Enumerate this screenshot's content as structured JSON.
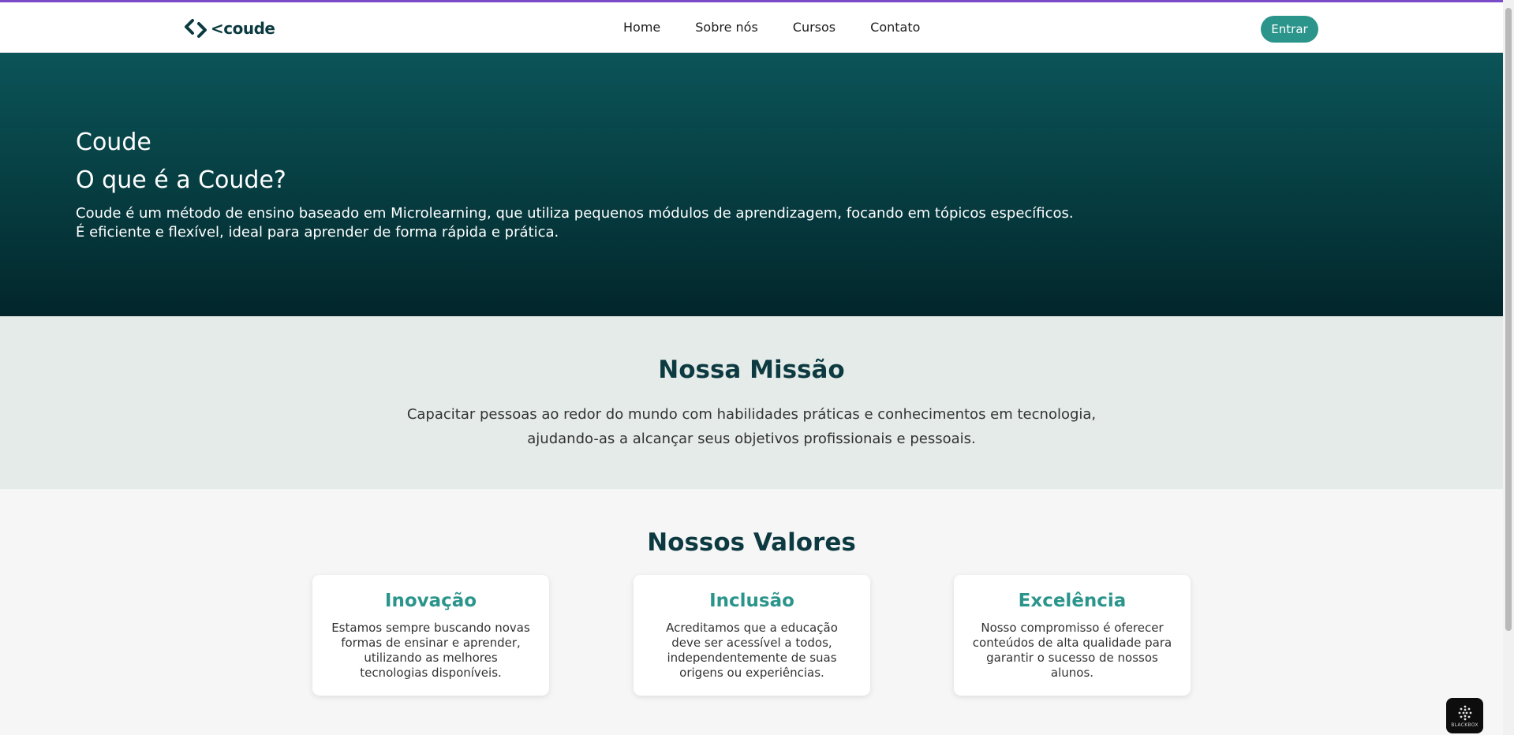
{
  "header": {
    "logo_text": "<coude",
    "nav": [
      "Home",
      "Sobre nós",
      "Cursos",
      "Contato"
    ],
    "login_label": "Entrar"
  },
  "hero": {
    "brand": "Coude",
    "title": "O que é a Coude?",
    "text_line1": "Coude é um método de ensino baseado em Microlearning, que utiliza pequenos módulos de aprendizagem, focando em tópicos específicos.",
    "text_line2": "É eficiente e flexível, ideal para aprender de forma rápida e prática."
  },
  "mission": {
    "title": "Nossa Missão",
    "text_line1": "Capacitar pessoas ao redor do mundo com habilidades práticas e conhecimentos em tecnologia,",
    "text_line2": "ajudando-as a alcançar seus objetivos profissionais e pessoais."
  },
  "values": {
    "title": "Nossos Valores",
    "cards": [
      {
        "title": "Inovação",
        "text": "Estamos sempre buscando novas formas de ensinar e aprender, utilizando as melhores tecnologias disponíveis."
      },
      {
        "title": "Inclusão",
        "text": "Acreditamos que a educação deve ser acessível a todos, independentemente de suas origens ou experiências."
      },
      {
        "title": "Excelência",
        "text": "Nosso compromisso é oferecer conteúdos de alta qualidade para garantir o sucesso de nossos alunos."
      }
    ]
  },
  "widget": {
    "label": "BLACKBOX",
    "icon": "blackbox-icon"
  },
  "colors": {
    "accent": "#2b958c",
    "hero_top": "#0b5458",
    "hero_bottom": "#02262b",
    "heading": "#0c3a40",
    "mission_bg": "#e5ebe9",
    "top_line": "#7c4bc8"
  }
}
